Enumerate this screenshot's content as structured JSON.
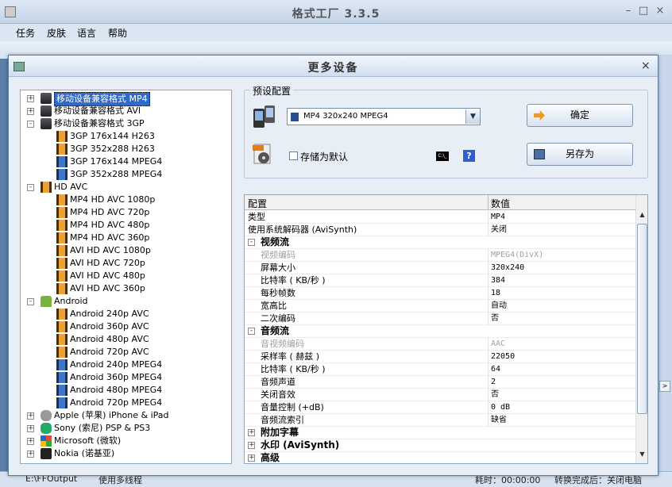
{
  "app": {
    "title": "格式工厂 3.3.5",
    "menu": [
      "任务",
      "皮肤",
      "语言",
      "帮助"
    ]
  },
  "status_bar": {
    "output_label": "E:\\FFOutput",
    "multithread_label": "使用多线程",
    "elapsed_label": "耗时：00:00:00",
    "after_convert_label": "转换完成后：关闭电脑"
  },
  "dialog": {
    "title": "更多设备",
    "close": "×",
    "tree": [
      {
        "label": "移动设备兼容格式 MP4",
        "level": 0,
        "expander": "+",
        "icon": "phone-icon",
        "selected": true
      },
      {
        "label": "移动设备兼容格式 AVI",
        "level": 0,
        "expander": "+",
        "icon": "phone-icon"
      },
      {
        "label": "移动设备兼容格式 3GP",
        "level": 0,
        "expander": "-",
        "icon": "phone-icon"
      },
      {
        "label": "3GP 176x144 H263",
        "level": 1,
        "icon": "film-icon"
      },
      {
        "label": "3GP 352x288 H263",
        "level": 1,
        "icon": "film-icon"
      },
      {
        "label": "3GP 176x144 MPEG4",
        "level": 1,
        "icon": "film-blue-icon"
      },
      {
        "label": "3GP 352x288 MPEG4",
        "level": 1,
        "icon": "film-blue-icon"
      },
      {
        "label": "HD AVC",
        "level": 0,
        "expander": "-",
        "icon": "film-icon"
      },
      {
        "label": "MP4 HD AVC 1080p",
        "level": 1,
        "icon": "film-icon"
      },
      {
        "label": "MP4 HD AVC 720p",
        "level": 1,
        "icon": "film-icon"
      },
      {
        "label": "MP4 HD AVC 480p",
        "level": 1,
        "icon": "film-icon"
      },
      {
        "label": "MP4 HD AVC 360p",
        "level": 1,
        "icon": "film-icon"
      },
      {
        "label": "AVI HD AVC 1080p",
        "level": 1,
        "icon": "film-icon"
      },
      {
        "label": "AVI HD AVC 720p",
        "level": 1,
        "icon": "film-icon"
      },
      {
        "label": "AVI HD AVC 480p",
        "level": 1,
        "icon": "film-icon"
      },
      {
        "label": "AVI HD AVC 360p",
        "level": 1,
        "icon": "film-icon"
      },
      {
        "label": "Android",
        "level": 0,
        "expander": "-",
        "icon": "android-icon"
      },
      {
        "label": "Android 240p AVC",
        "level": 1,
        "icon": "film-icon"
      },
      {
        "label": "Android 360p AVC",
        "level": 1,
        "icon": "film-icon"
      },
      {
        "label": "Android 480p AVC",
        "level": 1,
        "icon": "film-icon"
      },
      {
        "label": "Android 720p AVC",
        "level": 1,
        "icon": "film-icon"
      },
      {
        "label": "Android 240p MPEG4",
        "level": 1,
        "icon": "film-blue-icon"
      },
      {
        "label": "Android 360p MPEG4",
        "level": 1,
        "icon": "film-blue-icon"
      },
      {
        "label": "Android 480p MPEG4",
        "level": 1,
        "icon": "film-blue-icon"
      },
      {
        "label": "Android 720p MPEG4",
        "level": 1,
        "icon": "film-blue-icon"
      },
      {
        "label": "Apple (苹果) iPhone & iPad",
        "level": 0,
        "expander": "+",
        "icon": "apple-icon"
      },
      {
        "label": "Sony (索尼) PSP & PS3",
        "level": 0,
        "expander": "+",
        "icon": "sony-icon"
      },
      {
        "label": "Microsoft (微软)",
        "level": 0,
        "expander": "+",
        "icon": "microsoft-icon"
      },
      {
        "label": "Nokia (诺基亚)",
        "level": 0,
        "expander": "+",
        "icon": "nokia-icon"
      }
    ],
    "preset": {
      "group_label": "预设配置",
      "selected": "MP4 320x240 MPEG4",
      "save_default_label": "存储为默认",
      "ok_label": "确定",
      "save_as_label": "另存为",
      "cmd_icon_text": "C:\\_",
      "help_icon_text": "?"
    },
    "grid": {
      "col_config": "配置",
      "col_value": "数值",
      "rows": [
        {
          "type": "item",
          "name": "类型",
          "value": "MP4"
        },
        {
          "type": "item",
          "name": "使用系统解码器 (AviSynth)",
          "value": "关闭"
        },
        {
          "type": "category",
          "name": "视频流",
          "expander": "-"
        },
        {
          "type": "sub",
          "name": "视频编码",
          "value": "MPEG4(DivX)",
          "disabled": true
        },
        {
          "type": "sub",
          "name": "屏幕大小",
          "value": "320x240"
        },
        {
          "type": "sub",
          "name": "比特率 ( KB/秒 )",
          "value": "384"
        },
        {
          "type": "sub",
          "name": "每秒帧数",
          "value": "18"
        },
        {
          "type": "sub",
          "name": "宽高比",
          "value": "自动"
        },
        {
          "type": "sub",
          "name": "二次编码",
          "value": "否"
        },
        {
          "type": "category",
          "name": "音频流",
          "expander": "-"
        },
        {
          "type": "sub",
          "name": "音视频编码",
          "value": "AAC",
          "disabled": true
        },
        {
          "type": "sub",
          "name": "采样率 ( 赫兹 )",
          "value": "22050"
        },
        {
          "type": "sub",
          "name": "比特率 ( KB/秒 )",
          "value": "64"
        },
        {
          "type": "sub",
          "name": "音频声道",
          "value": "2"
        },
        {
          "type": "sub",
          "name": "关闭音效",
          "value": "否"
        },
        {
          "type": "sub",
          "name": "音量控制 (+dB)",
          "value": "0 dB"
        },
        {
          "type": "sub",
          "name": "音频流索引",
          "value": "缺省"
        },
        {
          "type": "category",
          "name": "附加字幕",
          "expander": "+"
        },
        {
          "type": "category",
          "name": "水印 (AviSynth)",
          "expander": "+"
        },
        {
          "type": "category",
          "name": "高级",
          "expander": "+"
        }
      ]
    }
  },
  "colors": {
    "selection": "#316ac5",
    "dialog_bg": "#e8eef6",
    "titlebar": "#d0def0",
    "disabled_text": "#a0a0a0"
  }
}
